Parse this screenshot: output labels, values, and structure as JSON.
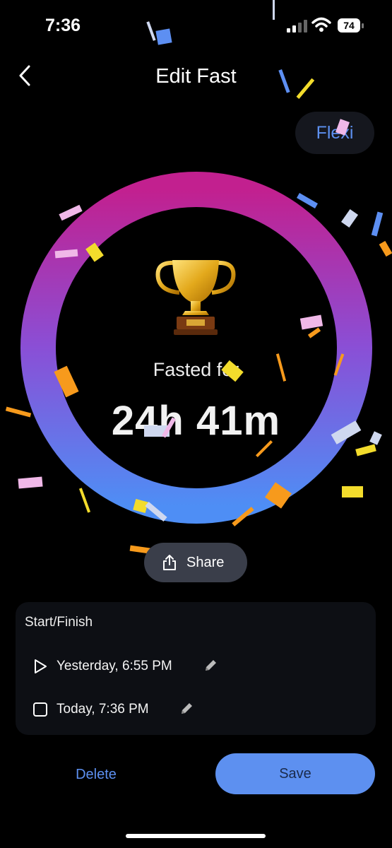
{
  "status_bar": {
    "time": "7:36",
    "battery": "74",
    "signal_icon": "cellular-signal-icon",
    "wifi_icon": "wifi-icon"
  },
  "nav": {
    "title": "Edit Fast",
    "back_icon": "chevron-left-icon"
  },
  "mode_badge": {
    "label": "Flexi"
  },
  "progress_ring": {
    "progress": 1.0,
    "colors": {
      "top": "#c2208f",
      "bottom": "#4e8ef5"
    }
  },
  "summary": {
    "trophy_icon": "trophy-icon",
    "label": "Fasted for",
    "duration": "24h 41m"
  },
  "share": {
    "label": "Share",
    "icon": "share-icon"
  },
  "schedule": {
    "title": "Start/Finish",
    "start": {
      "label": "Yesterday, 6:55 PM",
      "icon": "play-icon",
      "edit_icon": "pencil-icon"
    },
    "finish": {
      "label": "Today, 7:36 PM",
      "icon": "stop-icon",
      "edit_icon": "pencil-icon"
    }
  },
  "actions": {
    "delete_label": "Delete",
    "save_label": "Save"
  },
  "colors": {
    "accent": "#5d90f0",
    "background": "#000000",
    "card": "#0d0f14"
  }
}
